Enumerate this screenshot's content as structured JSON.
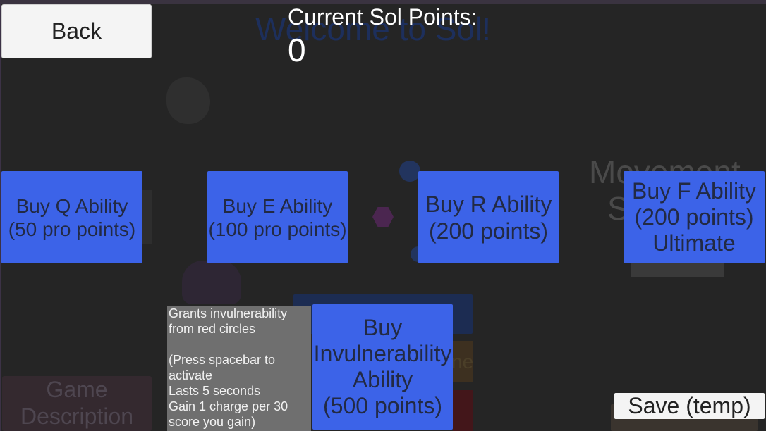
{
  "header": {
    "back_label": "Back",
    "points_label": "Current Sol Points:",
    "points_value": "0"
  },
  "background": {
    "title": "Welcome to Sol!",
    "movement_line1": "Movement",
    "movement_line2": "S",
    "game_description": "Game\nDescription",
    "orange_button_fragment": "ne"
  },
  "abilities": {
    "q": "Buy Q Ability\n(50 pro points)",
    "e": "Buy E Ability\n(100 pro points)",
    "r": "Buy R Ability\n(200 points)",
    "f": "Buy F Ability\n(200 points)\nUltimate",
    "invulnerability": "Buy\nInvulnerability\nAbility\n(500 points)"
  },
  "tooltip": {
    "text": "Grants invulnerability\nfrom red circles\n\n(Press spacebar to activate\nLasts 5 seconds\nGain 1 charge per 30 score you gain)"
  },
  "footer": {
    "save_label": "Save (temp)"
  },
  "colors": {
    "ability_button": "#3c63e8",
    "background": "#252525",
    "tooltip": "#6f6f6f",
    "button_light": "#f4f4f4"
  }
}
